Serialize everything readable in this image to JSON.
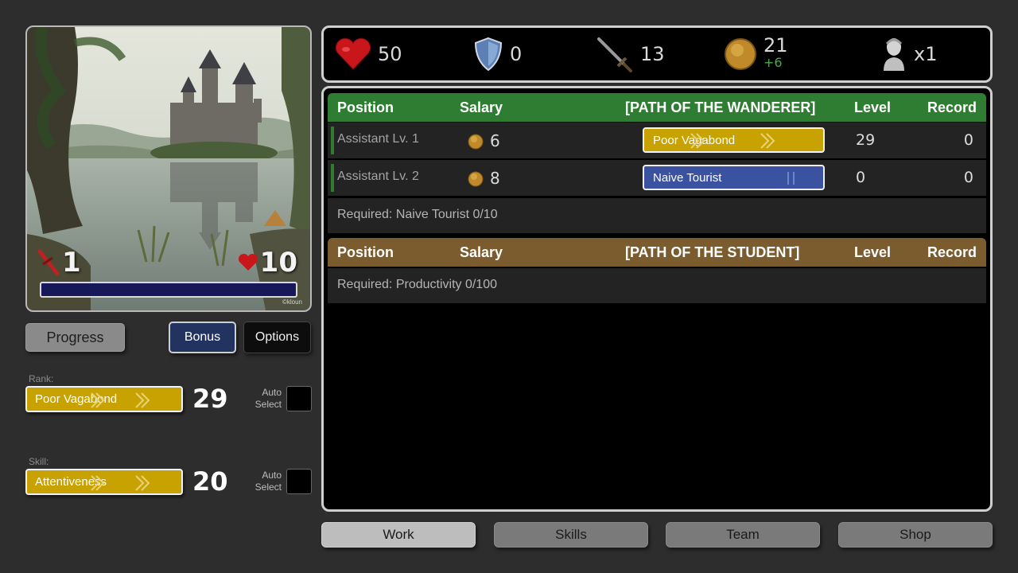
{
  "scene": {
    "attack_value": "1",
    "health_value": "10",
    "progress_fraction": 0,
    "credit": "©kloun"
  },
  "buttons": {
    "progress": "Progress",
    "bonus": "Bonus",
    "options": "Options"
  },
  "rank": {
    "label": "Rank:",
    "name": "Poor Vagabond",
    "level": "29",
    "auto_select": "Auto Select"
  },
  "skill": {
    "label": "Skill:",
    "name": "Attentiveness",
    "level": "20",
    "auto_select": "Auto Select"
  },
  "stats": {
    "health": "50",
    "armor": "0",
    "attack": "13",
    "gold": "21",
    "gold_bonus": "+6",
    "multiplier": "x1"
  },
  "columns": {
    "position": "Position",
    "salary": "Salary",
    "level": "Level",
    "record": "Record"
  },
  "paths": [
    {
      "title": "[PATH OF THE WANDERER]",
      "color": "#2e7d32",
      "jobs": [
        {
          "name": "Assistant Lv. 1",
          "salary": "6",
          "tier": "Poor Vagabond",
          "tier_color": "#c8a200",
          "level": "29",
          "record": "0"
        },
        {
          "name": "Assistant Lv. 2",
          "salary": "8",
          "tier": "Naive Tourist",
          "tier_color": "#3a52a0",
          "level": "0",
          "record": "0"
        }
      ],
      "required": "Required:  Naive Tourist 0/10"
    },
    {
      "title": "[PATH OF THE STUDENT]",
      "color": "#7a5c2e",
      "jobs": [],
      "required": "Required:  Productivity 0/100"
    }
  ],
  "tabs": [
    "Work",
    "Skills",
    "Team",
    "Shop"
  ],
  "active_tab": "Work"
}
